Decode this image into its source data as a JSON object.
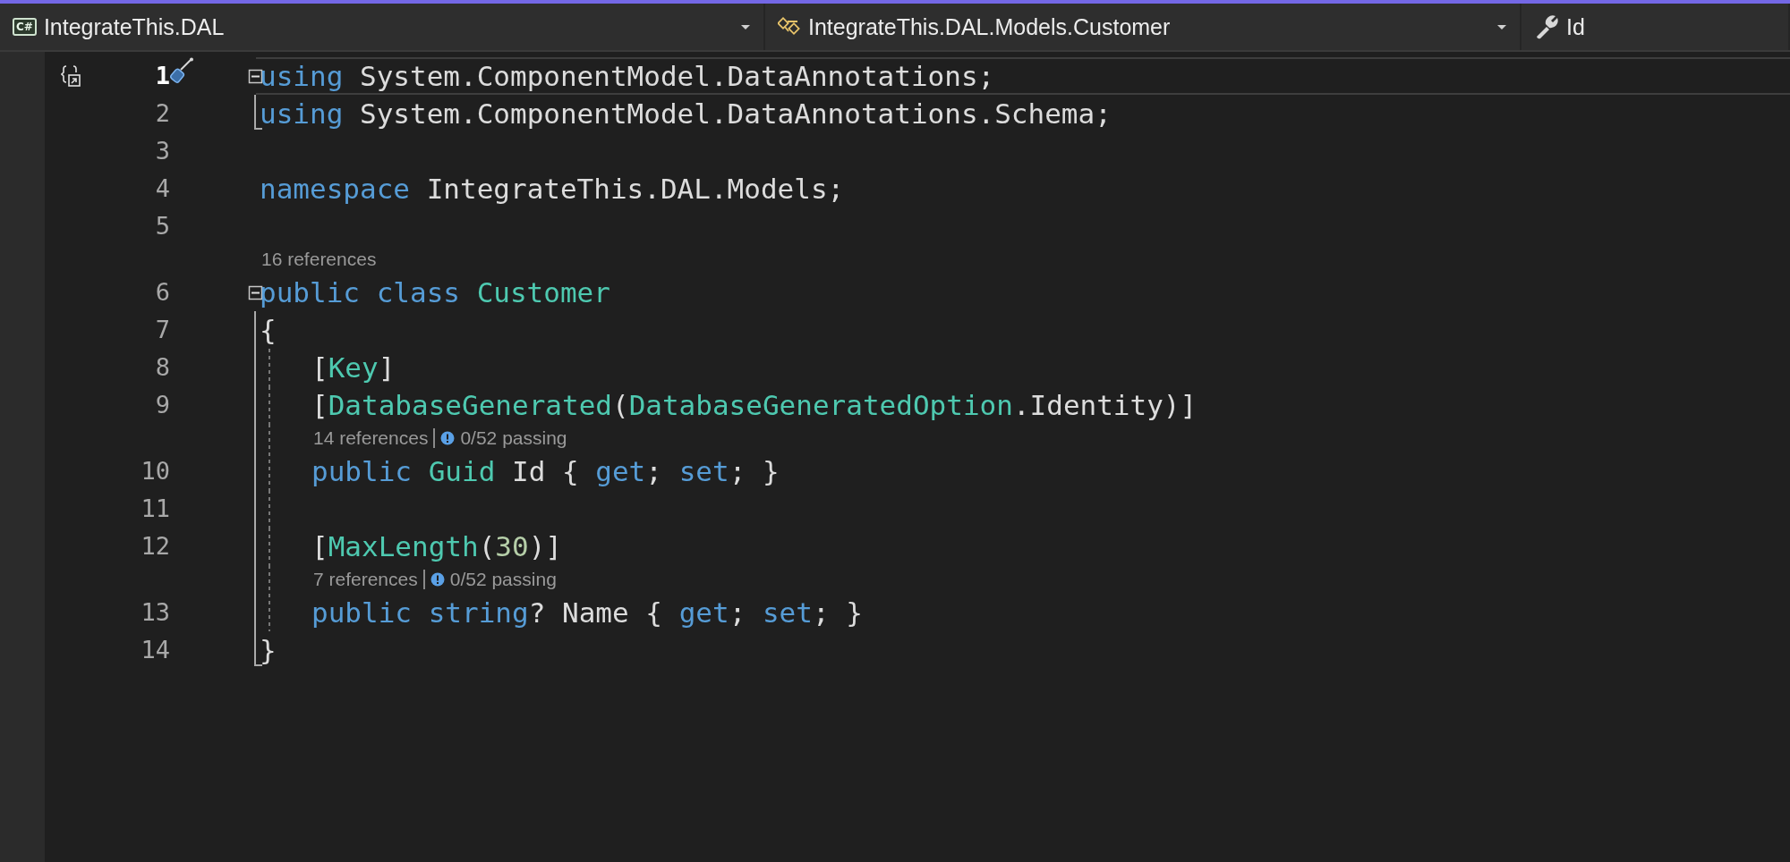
{
  "navigation_bar": {
    "project_icon": "C#",
    "project": "IntegrateThis.DAL",
    "type": "IntegrateThis.DAL.Models.Customer",
    "member": "Id"
  },
  "rows": [
    {
      "kind": "block",
      "expanded": true,
      "children": [
        {
          "kind": "code",
          "number": "1",
          "current": true,
          "tokens": [
            {
              "kind": "keyword",
              "text": "using"
            },
            {
              "kind": "plain",
              "text": " System.ComponentModel.DataAnnotations;"
            }
          ]
        },
        {
          "kind": "code",
          "number": "2",
          "current": false,
          "tokens": [
            {
              "kind": "keyword",
              "text": "using"
            },
            {
              "kind": "plain",
              "text": " System.ComponentModel.DataAnnotations.Schema;"
            }
          ]
        }
      ]
    },
    {
      "kind": "code",
      "number": "3",
      "current": false
    },
    {
      "kind": "code",
      "number": "4",
      "current": false,
      "tokens": [
        {
          "kind": "keyword",
          "text": "namespace"
        },
        {
          "kind": "plain",
          "text": " IntegrateThis.DAL.Models;"
        }
      ]
    },
    {
      "kind": "code",
      "number": "5",
      "current": false
    },
    {
      "kind": "lens",
      "references": "16 references"
    },
    {
      "kind": "block",
      "expanded": true,
      "children": [
        {
          "kind": "code",
          "number": "6",
          "current": false,
          "tokens": [
            {
              "kind": "keyword",
              "text": "public"
            },
            {
              "kind": "keyword",
              "text": " class"
            },
            {
              "kind": "type",
              "text": " Customer"
            }
          ]
        },
        {
          "kind": "code",
          "number": "7",
          "current": false,
          "tokens": [
            {
              "kind": "plain",
              "text": "{"
            }
          ]
        },
        {
          "kind": "indent",
          "children": [
            {
              "kind": "code",
              "number": "8",
              "current": false,
              "tokens": [
                {
                  "kind": "plain",
                  "text": "["
                },
                {
                  "kind": "type",
                  "text": "Key"
                },
                {
                  "kind": "plain",
                  "text": "]"
                }
              ]
            },
            {
              "kind": "code",
              "number": "9",
              "current": false,
              "tokens": [
                {
                  "kind": "plain",
                  "text": "["
                },
                {
                  "kind": "type",
                  "text": "DatabaseGenerated"
                },
                {
                  "kind": "plain",
                  "text": "("
                },
                {
                  "kind": "type",
                  "text": "DatabaseGeneratedOption"
                },
                {
                  "kind": "plain",
                  "text": ".Identity)]"
                }
              ]
            },
            {
              "kind": "lens",
              "references": "14 references",
              "tests": "0/52 passing"
            },
            {
              "kind": "code",
              "number": "10",
              "current": false,
              "tokens": [
                {
                  "kind": "keyword",
                  "text": "public"
                },
                {
                  "kind": "type",
                  "text": " Guid"
                },
                {
                  "kind": "plain",
                  "text": " Id { "
                },
                {
                  "kind": "keyword",
                  "text": "get"
                },
                {
                  "kind": "plain",
                  "text": "; "
                },
                {
                  "kind": "keyword",
                  "text": "set"
                },
                {
                  "kind": "plain",
                  "text": "; }"
                }
              ]
            },
            {
              "kind": "code",
              "number": "11",
              "current": false
            },
            {
              "kind": "code",
              "number": "12",
              "current": false,
              "tokens": [
                {
                  "kind": "plain",
                  "text": "["
                },
                {
                  "kind": "type",
                  "text": "MaxLength"
                },
                {
                  "kind": "plain",
                  "text": "("
                },
                {
                  "kind": "number",
                  "text": "30"
                },
                {
                  "kind": "plain",
                  "text": ")]"
                }
              ]
            },
            {
              "kind": "lens",
              "references": "7 references",
              "tests": "0/52 passing"
            },
            {
              "kind": "code",
              "number": "13",
              "current": false,
              "tokens": [
                {
                  "kind": "keyword",
                  "text": "public"
                },
                {
                  "kind": "keyword",
                  "text": " string"
                },
                {
                  "kind": "plain",
                  "text": "? Name { "
                },
                {
                  "kind": "keyword",
                  "text": "get"
                },
                {
                  "kind": "plain",
                  "text": "; "
                },
                {
                  "kind": "keyword",
                  "text": "set"
                },
                {
                  "kind": "plain",
                  "text": "; }"
                }
              ]
            }
          ]
        },
        {
          "kind": "code",
          "number": "14",
          "current": false,
          "tokens": [
            {
              "kind": "plain",
              "text": "}"
            }
          ]
        }
      ]
    }
  ]
}
